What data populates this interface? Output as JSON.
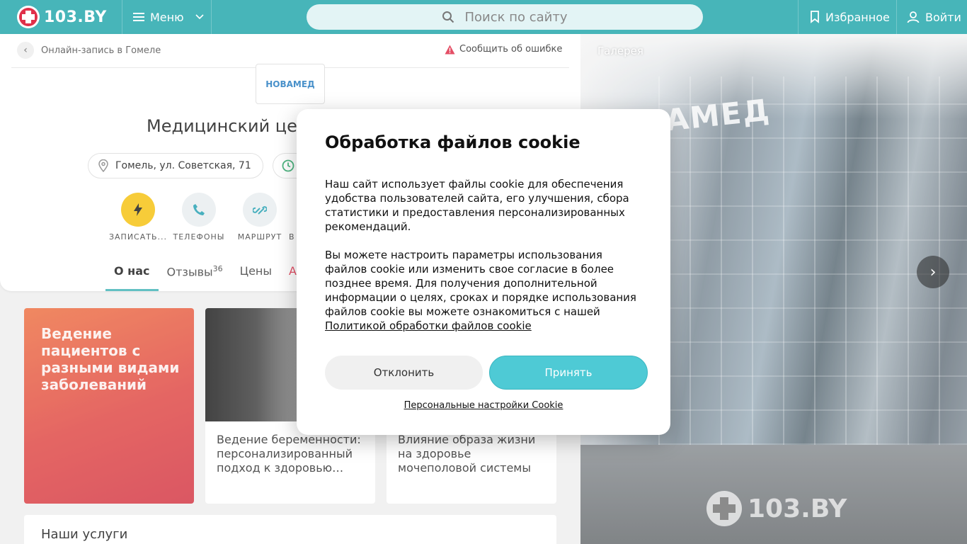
{
  "header": {
    "logo_text": "103.BY",
    "menu_label": "Меню",
    "search_placeholder": "Поиск по сайту",
    "favorites_label": "Избранное",
    "login_label": "Войти"
  },
  "breadcrumb": {
    "text": "Онлайн-запись в Гомеле"
  },
  "report_error": "Сообщить об ошибке",
  "clinic": {
    "logo_text": "НОВАМЕД",
    "title": "Медицинский це",
    "address": "Гомель, ул. Советская, 71"
  },
  "actions": [
    {
      "label": "ЗАПИСАТЬ..."
    },
    {
      "label": "ТЕЛЕФОНЫ"
    },
    {
      "label": "МАРШРУТ"
    },
    {
      "label": "В"
    }
  ],
  "tabs": [
    {
      "label": "О нас"
    },
    {
      "label": "Отзывы",
      "count": "36"
    },
    {
      "label": "Цены"
    },
    {
      "label": "Ак"
    }
  ],
  "cards": {
    "promo": "Ведение пациентов с разными видами заболеваний",
    "card1": "Ведение беременности: персонализированный подход к здоровью…",
    "card2": "Влияние образа жизни на здоровье мочеполовой системы"
  },
  "services_title": "Наши услуги",
  "gallery": {
    "title": "Галерея",
    "sign_text": "АМЕД",
    "watermark": "103.BY"
  },
  "cookie_modal": {
    "title": "Обработка файлов cookie",
    "paragraph1": "Наш сайт использует файлы cookie для обеспечения удобства пользователей сайта, его улучшения, сбора статистики и предоставления персонализированных рекомендаций.",
    "paragraph2": "Вы можете настроить параметры использования файлов cookie или изменить свое согласие в более позднее время. Для получения дополнительной информации о целях, сроках и порядке использования файлов cookie вы можете ознакомиться с нашей",
    "policy_link": "Политикой обработки файлов cookie",
    "decline_label": "Отклонить",
    "accept_label": "Принять",
    "settings_link": "Персональные настройки Cookie"
  },
  "colors": {
    "brand_teal": "#47b5b9",
    "accept_button": "#4ecad5",
    "accent_yellow": "#f6c417",
    "accent_red": "#e0304a"
  },
  "icons": [
    "hamburger-icon",
    "chevron-down-icon",
    "search-icon",
    "bookmark-icon",
    "user-icon",
    "chevron-left-icon",
    "warning-icon",
    "pin-icon",
    "clock-icon",
    "lightning-icon",
    "phone-icon",
    "route-icon",
    "chevron-right-icon"
  ]
}
